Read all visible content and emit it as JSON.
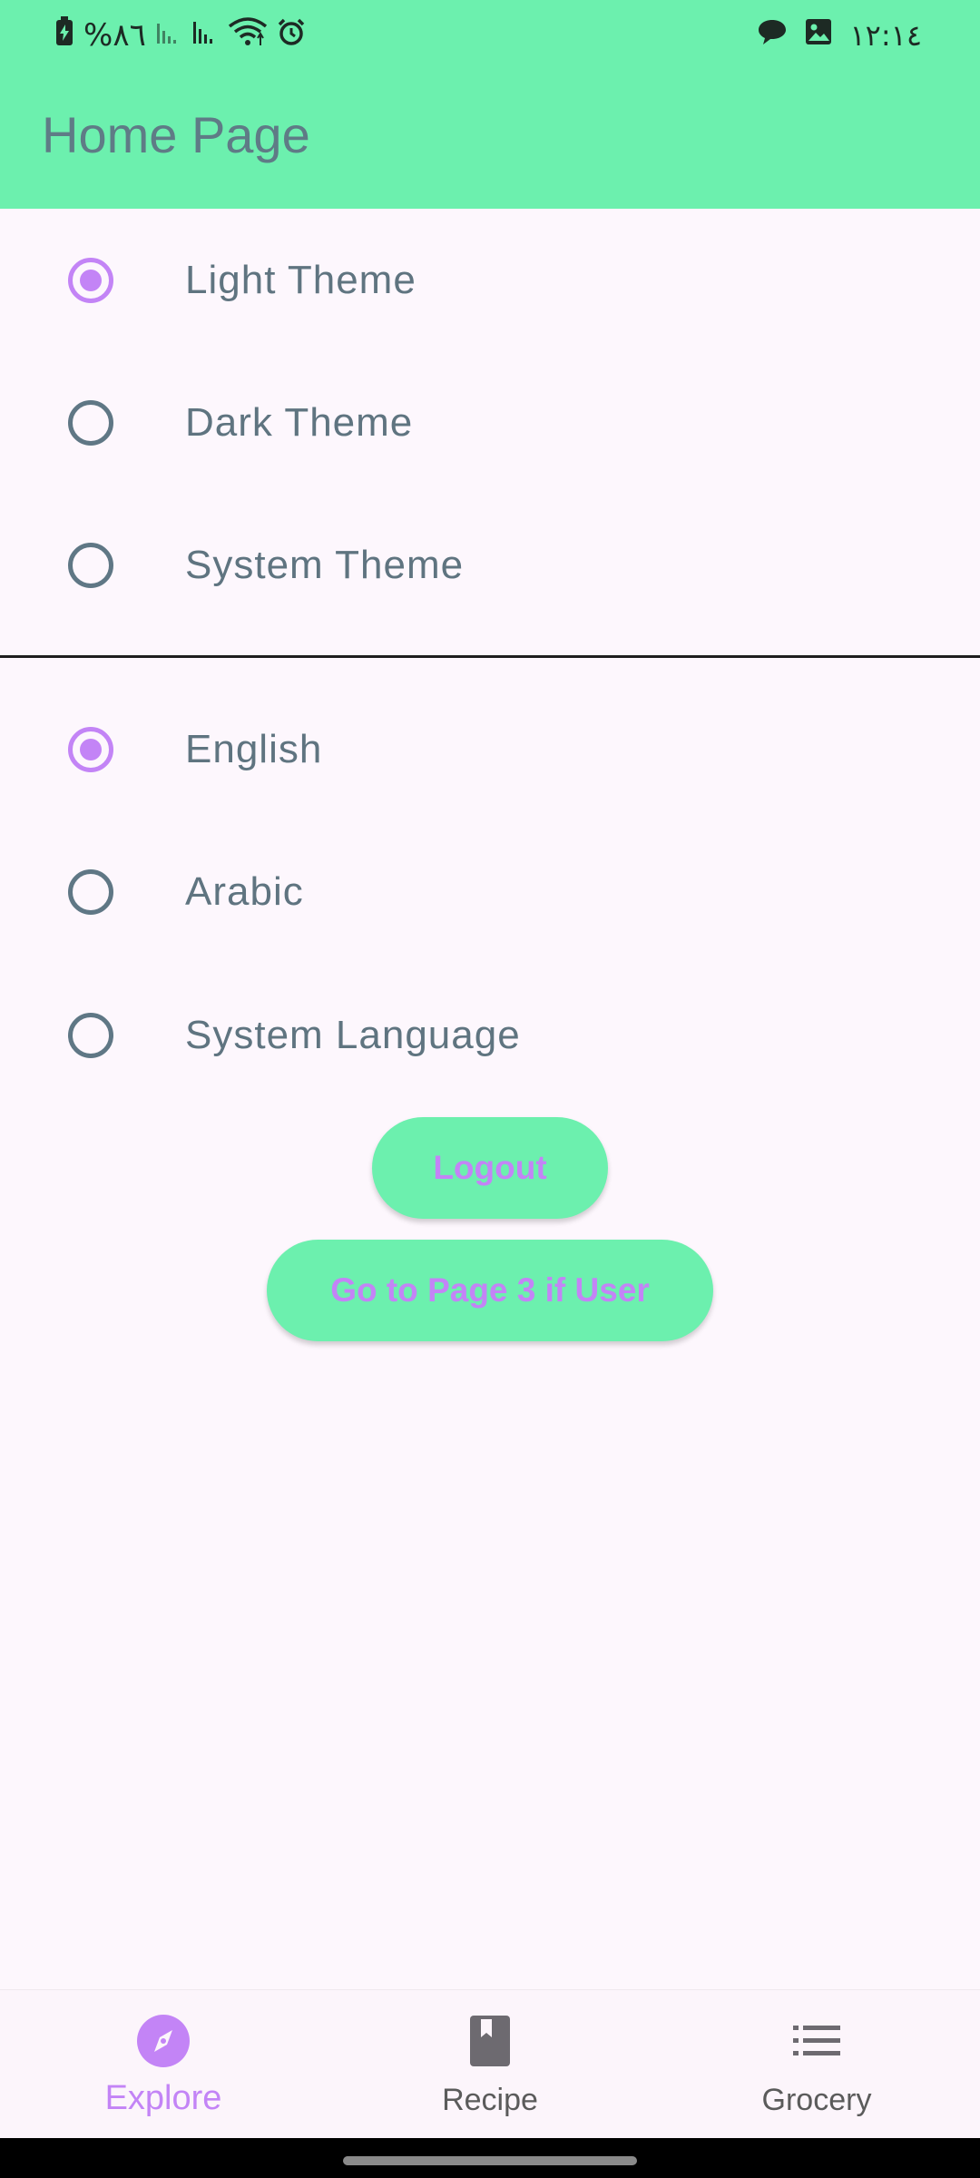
{
  "status_bar": {
    "battery_percent": "%٨٦",
    "time": "١٢:١٤",
    "left_icons": [
      "battery-charging-icon",
      "signal-icon",
      "signal-icon",
      "wifi-icon",
      "alarm-icon"
    ],
    "right_icons": [
      "chat-icon",
      "image-icon"
    ]
  },
  "app_bar": {
    "title": "Home Page"
  },
  "theme_options": [
    {
      "label": "Light Theme",
      "selected": true
    },
    {
      "label": "Dark Theme",
      "selected": false
    },
    {
      "label": "System Theme",
      "selected": false
    }
  ],
  "language_options": [
    {
      "label": "English",
      "selected": true
    },
    {
      "label": "Arabic",
      "selected": false
    },
    {
      "label": "System Language",
      "selected": false
    }
  ],
  "buttons": {
    "logout": "Logout",
    "page3": "Go to Page 3 if User"
  },
  "bottom_nav": {
    "items": [
      {
        "label": "Explore",
        "icon": "compass-icon",
        "active": true
      },
      {
        "label": "Recipe",
        "icon": "book-icon",
        "active": false
      },
      {
        "label": "Grocery",
        "icon": "list-icon",
        "active": false
      }
    ]
  },
  "colors": {
    "app_bar": "#6cf0ae",
    "accent": "#c384f6",
    "background": "#fdf7fd",
    "text": "#5f7480"
  }
}
